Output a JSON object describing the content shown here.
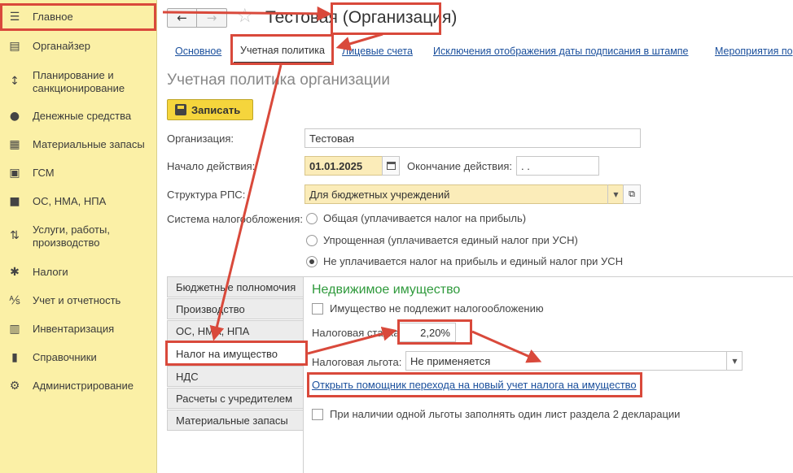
{
  "sidebar": {
    "items": [
      {
        "label": "Главное",
        "icon": "menu-icon"
      },
      {
        "label": "Органайзер",
        "icon": "organizer-icon"
      },
      {
        "label": "Планирование и санкционирование",
        "icon": "planning-icon"
      },
      {
        "label": "Денежные средства",
        "icon": "money-icon"
      },
      {
        "label": "Материальные запасы",
        "icon": "inventory-icon"
      },
      {
        "label": "ГСМ",
        "icon": "fuel-icon"
      },
      {
        "label": "ОС, НМА, НПА",
        "icon": "truck-icon"
      },
      {
        "label": "Услуги, работы, производство",
        "icon": "services-icon"
      },
      {
        "label": "Налоги",
        "icon": "taxes-icon"
      },
      {
        "label": "Учет и отчетность",
        "icon": "accounting-icon"
      },
      {
        "label": "Инвентаризация",
        "icon": "stocktaking-icon"
      },
      {
        "label": "Справочники",
        "icon": "catalogs-icon"
      },
      {
        "label": "Администрирование",
        "icon": "gear-icon"
      }
    ]
  },
  "header": {
    "title": "Тестовая (Организация)"
  },
  "tabs": {
    "main": "Основное",
    "policy": "Учетная политика",
    "accounts": "Лицевые счета",
    "exclusions": "Исключения отображения даты подписания в штампе",
    "events": "Мероприятия по"
  },
  "form": {
    "section_title": "Учетная политика организации",
    "save_label": "Записать",
    "org_label": "Организация:",
    "org_value": "Тестовая",
    "start_label": "Начало действия:",
    "start_value": "01.01.2025",
    "end_label": "Окончание действия:",
    "end_value": " .  . ",
    "rps_label": "Структура РПС:",
    "rps_value": "Для бюджетных учреждений",
    "tax_system_label": "Система налогообложения:",
    "tax_options": [
      "Общая (уплачивается налог на прибыль)",
      "Упрощенная (уплачивается единый налог при УСН)",
      "Не уплачивается налог на прибыль и единый налог при УСН"
    ]
  },
  "side_tabs": [
    "Бюджетные полномочия",
    "Производство",
    "ОС, НМА, НПА",
    "Налог на имущество",
    "НДС",
    "Расчеты с учредителем",
    "Материальные запасы"
  ],
  "property": {
    "title": "Недвижимое имущество",
    "not_taxable": "Имущество не подлежит налогообложению",
    "rate_label": "Налоговая ставка:",
    "rate_value": "2,20%",
    "benefit_label": "Налоговая льгота:",
    "benefit_value": "Не применяется",
    "helper_link": "Открыть помощник перехода на новый учет налога на имущество",
    "one_sheet": "При наличии одной льготы заполнять один лист раздела 2 декларации"
  },
  "colors": {
    "sidebar_bg": "#fbf0a6",
    "annotation": "#d9493b",
    "section_green": "#2f9a3c",
    "link_blue": "#1a4f9c",
    "save_yellow": "#f5d53c"
  }
}
